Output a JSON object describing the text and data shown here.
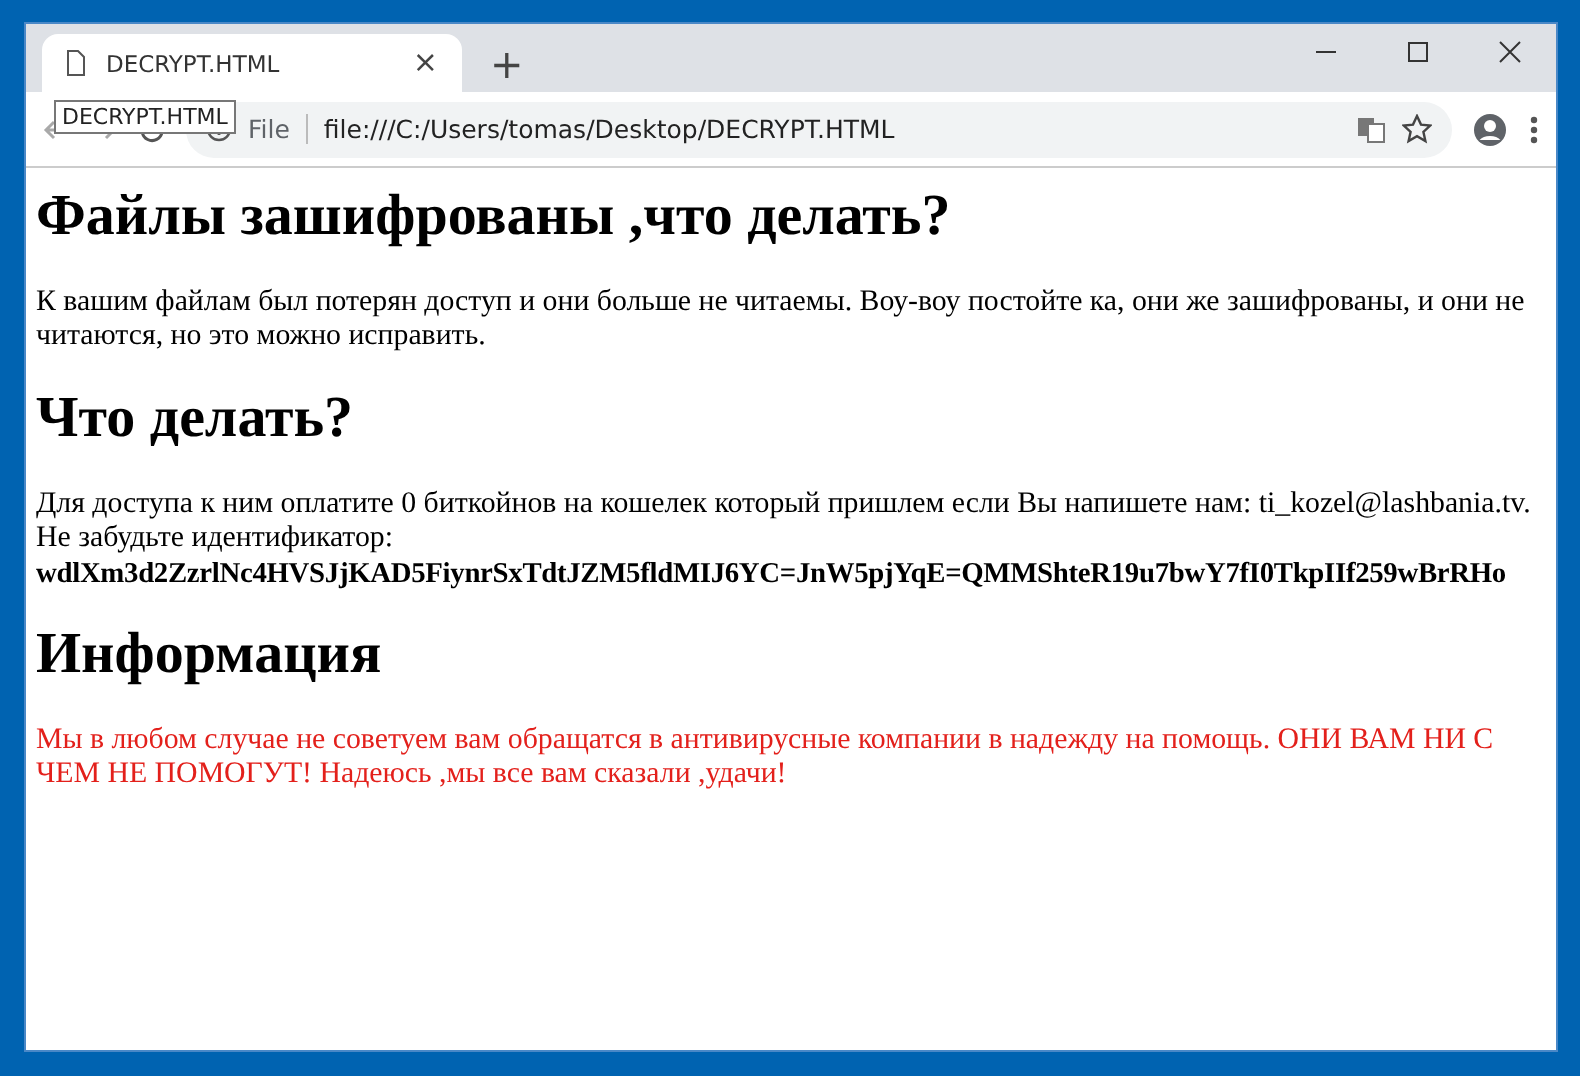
{
  "tab": {
    "title": "DECRYPT.HTML",
    "close": "×"
  },
  "new_tab": "+",
  "tooltip": "DECRYPT.HTML",
  "address": {
    "scheme": "File",
    "url": "file:///C:/Users/tomas/Desktop/DECRYPT.HTML"
  },
  "content": [
    {
      "kind": "heading",
      "text": "Файлы зашифрованы ,что делать?"
    },
    {
      "kind": "paragraph",
      "text": "К вашим файлам был потерян доступ и они больше не читаемы. Воу-воу постойте ка, они же зашифрованы, и они не читаются, но это можно исправить."
    },
    {
      "kind": "heading",
      "text": "Что делать?"
    },
    {
      "kind": "paragraph",
      "text": "Для доступа к ним оплатите 0 биткойнов на кошелек который пришлем если Вы напишете нам: ti_kozel@lashbania.tv. Не забудьте идентификатор:"
    },
    {
      "kind": "code",
      "text": "wdlXm3d2ZzrlNc4HVSJjKAD5FiynrSxTdtJZM5fldMIJ6YC=JnW5pjYqE=QMMShteR19u7bwY7fI0TkpIIf259wBrRHo"
    },
    {
      "kind": "heading",
      "text": "Информация"
    },
    {
      "kind": "alert",
      "text": "Мы в любом случае не советуем вам обращатся в антивирусные компании в надежду на помощь. ОНИ ВАМ НИ С ЧЕМ НЕ ПОМОГУТ! Надеюсь ,мы все вам сказали ,удачи!"
    }
  ]
}
